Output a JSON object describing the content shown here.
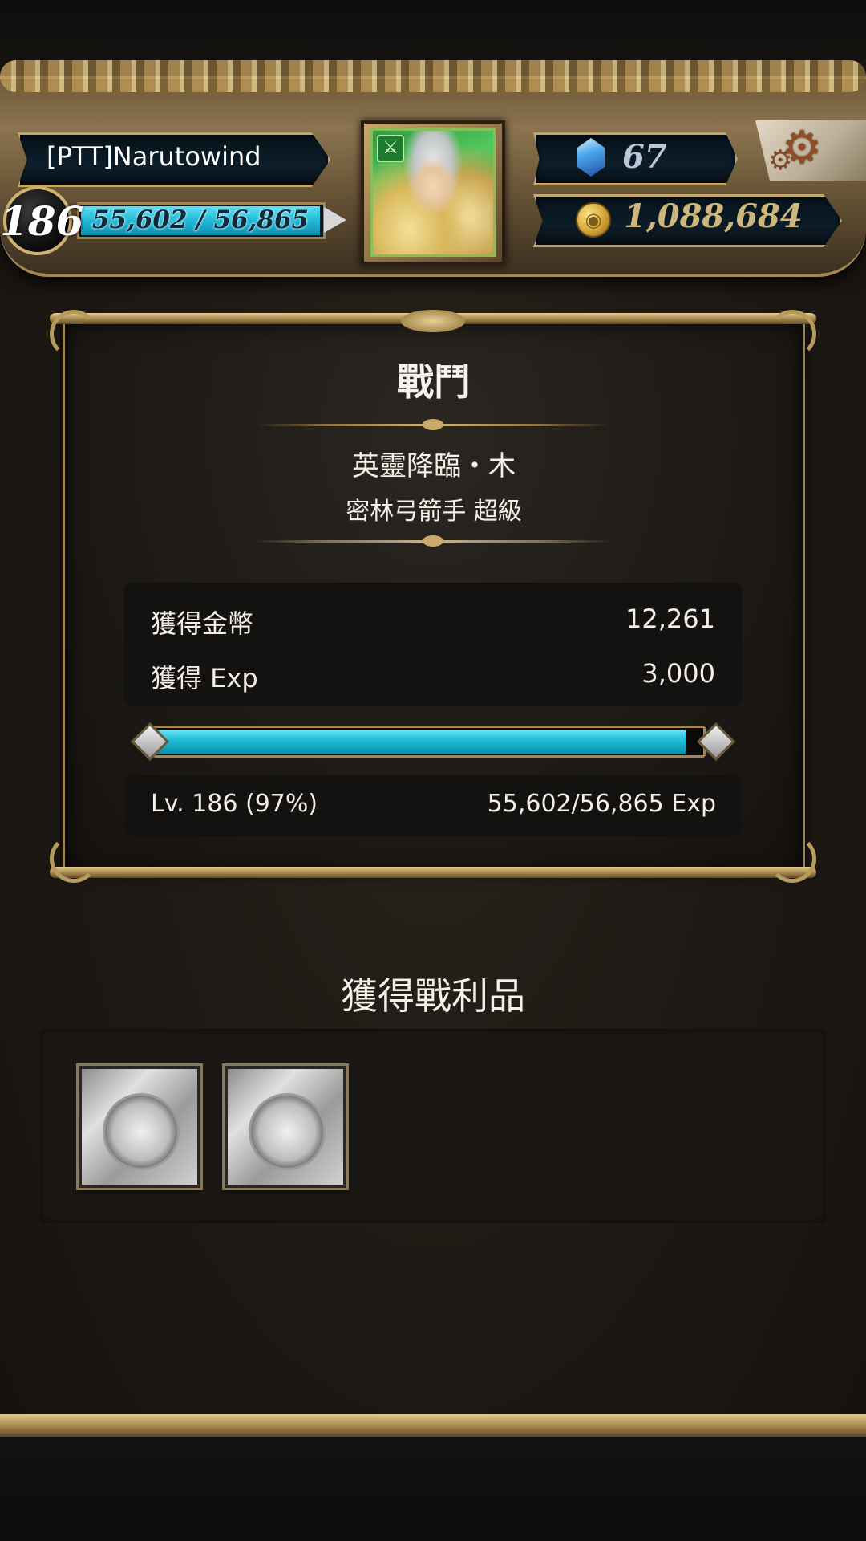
{
  "header": {
    "player_name": "[PTT]Narutowind",
    "level": "186",
    "exp_text": "55,602 / 56,865",
    "gems": "67",
    "coins": "1,088,684"
  },
  "battle": {
    "title": "戰鬥",
    "stage_name": "英靈降臨・木",
    "stage_difficulty": "密林弓箭手 超級",
    "rewards": {
      "coins_label": "獲得金幣",
      "coins_value": "12,261",
      "exp_label": "獲得 Exp",
      "exp_value": "3,000"
    },
    "progress": {
      "level_text": "Lv. 186 (97%)",
      "exp_text": "55,602/56,865 Exp",
      "fraction": 0.97
    }
  },
  "loot": {
    "title": "獲得戰利品",
    "items": [
      "silver-seal-card",
      "silver-seal-card"
    ]
  },
  "colors": {
    "accent_cyan": "#22b7d6",
    "frame_gold": "#c9a969"
  }
}
